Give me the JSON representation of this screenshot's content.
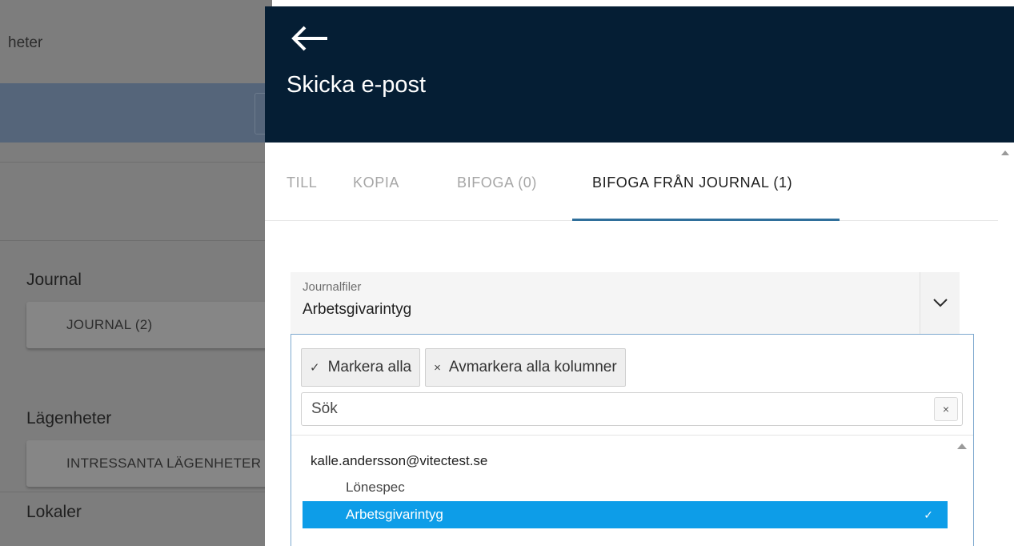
{
  "background": {
    "header_text": "heter",
    "sections": [
      {
        "title": "Journal",
        "card": "JOURNAL (2)"
      },
      {
        "title": "Lägenheter",
        "card": "INTRESSANTA LÄGENHETER"
      },
      {
        "title": "Lokaler"
      }
    ]
  },
  "drawer": {
    "title": "Skicka e-post",
    "tabs": [
      {
        "label": "TILL"
      },
      {
        "label": "KOPIA"
      },
      {
        "label": "BIFOGA (0)"
      },
      {
        "label": "BIFOGA FRÅN JOURNAL (1)",
        "active": true
      }
    ],
    "select": {
      "label": "Journalfiler",
      "value": "Arbetsgivarintyg"
    },
    "dropdown": {
      "select_all_label": "Markera alla",
      "deselect_all_label": "Avmarkera alla kolumner",
      "search_placeholder": "Sök",
      "clear_label": "×",
      "group": "kalle.andersson@vitectest.se",
      "options": [
        {
          "label": "Lönespec",
          "selected": false
        },
        {
          "label": "Arbetsgivarintyg",
          "selected": true
        }
      ]
    }
  },
  "colors": {
    "header_bg": "#051e34",
    "tab_indicator": "#2f6f9b",
    "selected_option": "#0d9de8"
  },
  "icons": [
    "arrow-left-icon",
    "chevron-down-icon",
    "check-icon",
    "close-icon",
    "scroll-up-icon"
  ]
}
